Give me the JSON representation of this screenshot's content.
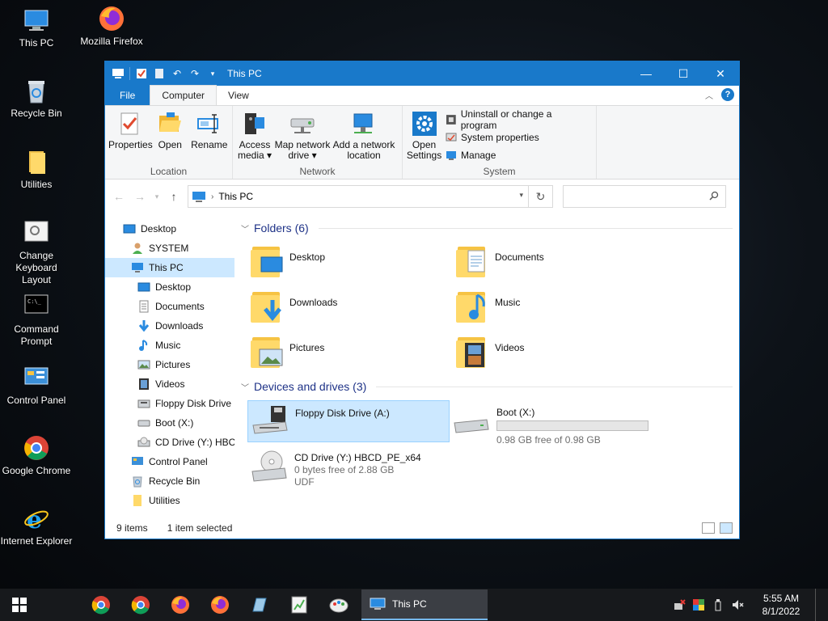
{
  "desktop": {
    "icons": [
      {
        "label": "This PC"
      },
      {
        "label": "Mozilla Firefox"
      },
      {
        "label": "Recycle Bin"
      },
      {
        "label": "Utilities"
      },
      {
        "label": "Change Keyboard Layout"
      },
      {
        "label": "Command Prompt"
      },
      {
        "label": "Control Panel"
      },
      {
        "label": "Google Chrome"
      },
      {
        "label": "Internet Explorer"
      }
    ]
  },
  "window": {
    "title": "This PC",
    "tabs": {
      "file": "File",
      "computer": "Computer",
      "view": "View"
    },
    "help": "?",
    "ribbon": {
      "location": {
        "name": "Location",
        "properties": "Properties",
        "open": "Open",
        "rename": "Rename"
      },
      "network": {
        "name": "Network",
        "access_media_1": "Access",
        "access_media_2": "media ▾",
        "map_drive_1": "Map network",
        "map_drive_2": "drive ▾",
        "add_location_1": "Add a network",
        "add_location_2": "location"
      },
      "system": {
        "name": "System",
        "open_settings_1": "Open",
        "open_settings_2": "Settings",
        "uninstall": "Uninstall or change a program",
        "system_properties": "System properties",
        "manage": "Manage"
      }
    },
    "address": {
      "path": "This PC",
      "search_placeholder": ""
    },
    "nav": [
      {
        "label": "Desktop"
      },
      {
        "label": "SYSTEM"
      },
      {
        "label": "This PC"
      },
      {
        "label": "Desktop"
      },
      {
        "label": "Documents"
      },
      {
        "label": "Downloads"
      },
      {
        "label": "Music"
      },
      {
        "label": "Pictures"
      },
      {
        "label": "Videos"
      },
      {
        "label": "Floppy Disk Drive"
      },
      {
        "label": "Boot (X:)"
      },
      {
        "label": "CD Drive (Y:) HBC"
      },
      {
        "label": "Control Panel"
      },
      {
        "label": "Recycle Bin"
      },
      {
        "label": "Utilities"
      }
    ],
    "folders_header": "Folders (6)",
    "folders": [
      {
        "name": "Desktop"
      },
      {
        "name": "Documents"
      },
      {
        "name": "Downloads"
      },
      {
        "name": "Music"
      },
      {
        "name": "Pictures"
      },
      {
        "name": "Videos"
      }
    ],
    "drives_header": "Devices and drives (3)",
    "drives": [
      {
        "name": "Floppy Disk Drive (A:)"
      },
      {
        "name": "Boot (X:)",
        "free": "0.98 GB free of 0.98 GB",
        "used_fraction": 0.0
      },
      {
        "name": "CD Drive (Y:) HBCD_PE_x64",
        "free": "0 bytes free of 2.88 GB",
        "fs": "UDF"
      }
    ],
    "status": {
      "items": "9 items",
      "selected": "1 item selected"
    }
  },
  "taskbar": {
    "active_label": "This PC",
    "time": "5:55 AM",
    "date": "8/1/2022"
  },
  "colors": {
    "accent": "#1979ca",
    "selection": "#cce8ff",
    "folder": "#ffd96a"
  }
}
